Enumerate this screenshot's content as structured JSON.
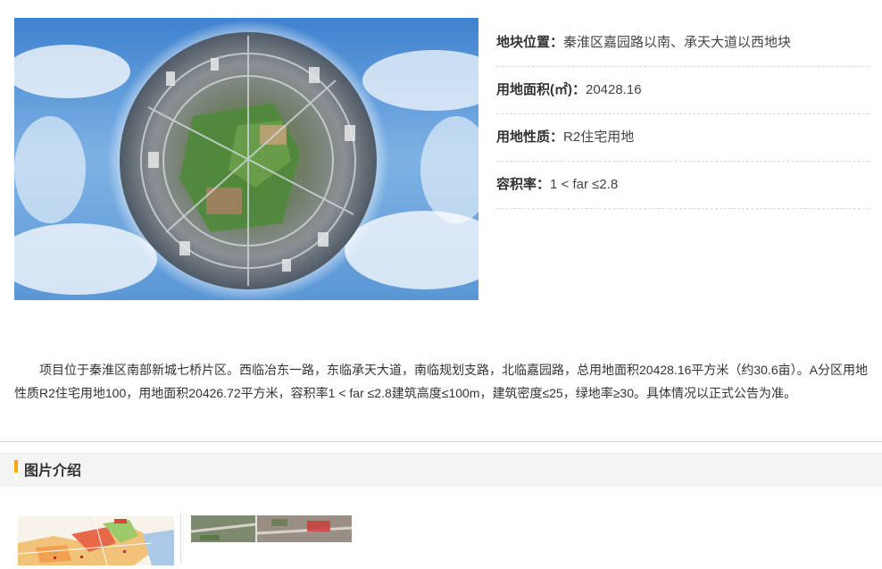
{
  "hero": {
    "image": "tiny-planet-aerial-photo"
  },
  "info": [
    {
      "label": "地块位置：",
      "value": "秦淮区嘉园路以南、承天大道以西地块"
    },
    {
      "label": "用地面积(㎡)：",
      "value": "20428.16"
    },
    {
      "label": "用地性质：",
      "value": "R2住宅用地"
    },
    {
      "label": "容积率：",
      "value": "1 < far ≤2.8"
    }
  ],
  "description": "项目位于秦淮区南部新城七桥片区。西临冶东一路，东临承天大道，南临规划支路，北临嘉园路，总用地面积20428.16平方米（约30.6亩）。A分区用地性质R2住宅用地100，用地面积20426.72平方米，容积率1 < far ≤2.8建筑高度≤100m，建筑密度≤25，绿地率≥30。具体情况以正式公告为准。",
  "section": {
    "title": "图片介绍"
  },
  "thumbnails": [
    {
      "image": "site-plan-map-thumbnail"
    },
    {
      "image": "aerial-photo-thumbnail"
    }
  ],
  "colors": {
    "accent": "#f5a800",
    "sky": "#5b97d6",
    "greenery": "#4f8a3a"
  }
}
